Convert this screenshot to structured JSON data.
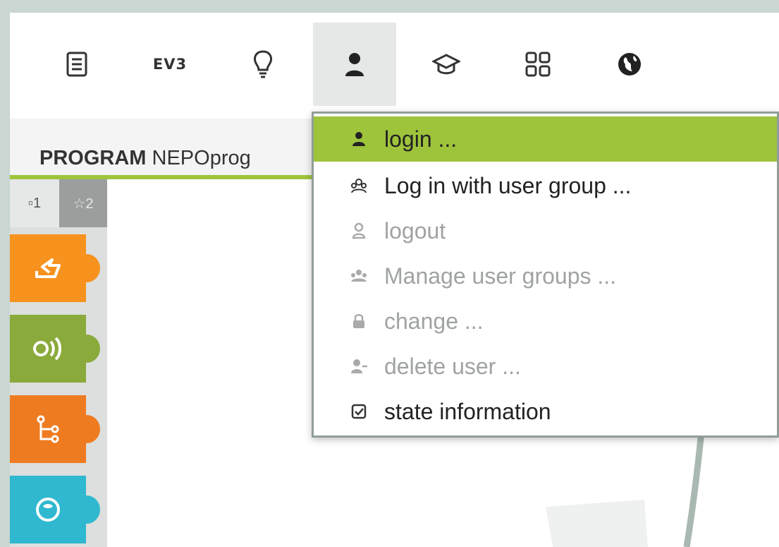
{
  "toolbar": {
    "items": [
      {
        "name": "program-icon"
      },
      {
        "name": "ev3-robot",
        "label": "EV3"
      },
      {
        "name": "lightbulb-icon"
      },
      {
        "name": "user-icon",
        "active": true
      },
      {
        "name": "graduation-cap-icon"
      },
      {
        "name": "gallery-grid-icon"
      },
      {
        "name": "globe-icon"
      }
    ]
  },
  "program_tab": {
    "prefix": "PROGRAM",
    "name": "NEPOprog"
  },
  "palette": {
    "tabs": [
      "▫1",
      "☆2"
    ],
    "blocks": [
      {
        "name": "action-block",
        "color": "#f7921e",
        "icon": "action-arrow-icon"
      },
      {
        "name": "sensor-block",
        "color": "#8aaa3b",
        "icon": "sound-sensor-icon"
      },
      {
        "name": "control-block",
        "color": "#ef7b21",
        "icon": "branch-icon"
      },
      {
        "name": "logic-block",
        "color": "#2fb8cf",
        "icon": "brain-icon"
      }
    ]
  },
  "user_menu": {
    "items": [
      {
        "label": "login ...",
        "icon": "user-icon",
        "state": "highlight"
      },
      {
        "label": "Log in with user group ...",
        "icon": "user-group-icon",
        "state": "enabled"
      },
      {
        "label": "logout",
        "icon": "user-outline-icon",
        "state": "disabled"
      },
      {
        "label": "Manage user groups ...",
        "icon": "users-icon",
        "state": "disabled"
      },
      {
        "label": "change ...",
        "icon": "lock-icon",
        "state": "disabled"
      },
      {
        "label": "delete user ...",
        "icon": "user-minus-icon",
        "state": "disabled"
      },
      {
        "label": "state information",
        "icon": "checkbox-icon",
        "state": "enabled"
      }
    ]
  },
  "colors": {
    "accent": "#9ec43c",
    "menu_border": "#909e98",
    "disabled_text": "#9fa3a1"
  }
}
